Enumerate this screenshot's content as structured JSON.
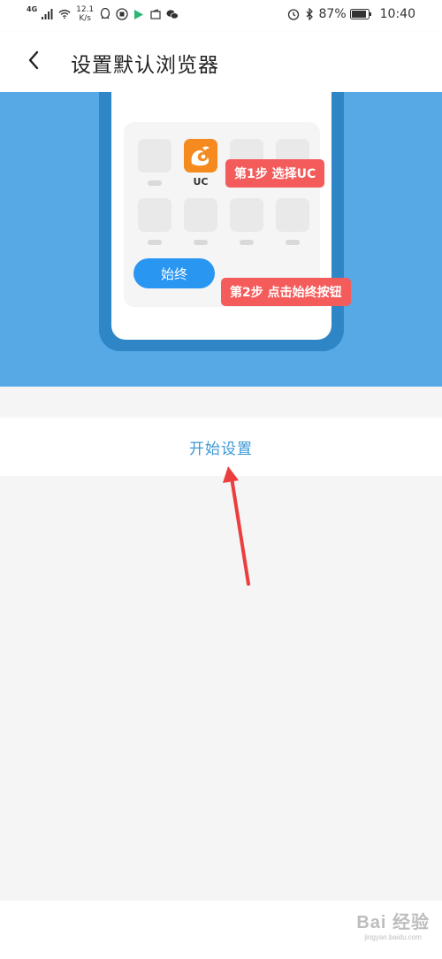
{
  "status_bar": {
    "network_type": "4G",
    "speed_value": "12.1",
    "speed_unit": "K/s",
    "battery": "87%",
    "time": "10:40",
    "icons": [
      "signal-icon",
      "wifi-icon",
      "qq-icon",
      "app-icon",
      "play-icon",
      "wallet-icon",
      "wechat-icon",
      "alarm-icon",
      "bluetooth-icon",
      "battery-icon"
    ]
  },
  "header": {
    "title": "设置默认浏览器",
    "back_icon": "chevron-left-icon"
  },
  "illustration": {
    "uc_label": "UC",
    "always_label": "始终",
    "step1": "第1步  选择UC",
    "step2": "第2步  点击始终按钮",
    "colors": {
      "hero_bg": "#56a9e4",
      "phone_frame": "#2e86c6",
      "uc_orange": "#f58a1f",
      "step_red": "#f45b5b",
      "button_blue": "#2996f2"
    }
  },
  "action": {
    "start_label": "开始设置"
  },
  "watermark": {
    "main": "Bai 经验",
    "sub": "jingyan.baidu.com"
  }
}
